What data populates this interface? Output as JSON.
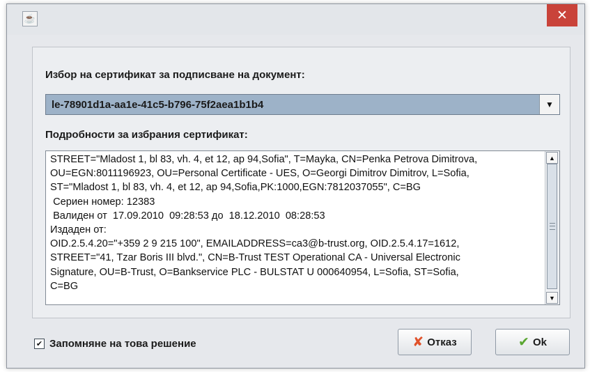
{
  "window": {
    "app_icon": "java-cup-icon",
    "close_glyph": "✕"
  },
  "certificate_select": {
    "label": "Избор на сертификат за подписване на документ:",
    "selected_value": "le-78901d1a-aa1e-41c5-b796-75f2aea1b1b4"
  },
  "certificate_details": {
    "label": "Подробности за избрания сертификат:",
    "text": "STREET=\"Mladost 1, bl 83, vh. 4, et 12, ap 94,Sofia\", T=Mayka, CN=Penka Petrova Dimitrova,\nOU=EGN:8011196923, OU=Personal Certificate - UES, O=Georgi Dimitrov Dimitrov, L=Sofia,\nST=\"Mladost 1, bl 83, vh. 4, et 12, ap 94,Sofia,PK:1000,EGN:7812037055\", C=BG\n Сериен номер: 12383\n Валиден от  17.09.2010  09:28:53 до  18.12.2010  08:28:53\nИздаден от:\nOID.2.5.4.20=\"+359 2 9 215 100\", EMAILADDRESS=ca3@b-trust.org, OID.2.5.4.17=1612,\nSTREET=\"41, Tzar Boris III blvd.\", CN=B-Trust TEST Operational CA - Universal Electronic\nSignature, OU=B-Trust, O=Bankservice PLC - BULSTAT U 000640954, L=Sofia, ST=Sofia,\nC=BG"
  },
  "remember": {
    "label": "Запомняне на това решение",
    "checked": true,
    "check_glyph": "✔"
  },
  "buttons": {
    "cancel_label": "Отказ",
    "cancel_icon": "✘",
    "ok_label": "Ok",
    "ok_icon": "✔"
  },
  "colors": {
    "combo_selection": "#9db2c8",
    "close_button": "#c9433a",
    "cancel_icon": "#e0522b",
    "ok_icon": "#5aa631"
  }
}
